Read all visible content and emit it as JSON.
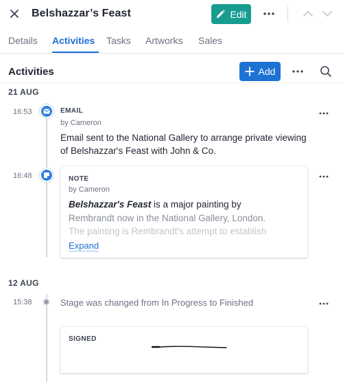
{
  "header": {
    "title": "Belshazzar’s Feast",
    "edit_label": "Edit"
  },
  "tabs": [
    {
      "label": "Details"
    },
    {
      "label": "Activities"
    },
    {
      "label": "Tasks"
    },
    {
      "label": "Artworks"
    },
    {
      "label": "Sales"
    }
  ],
  "section": {
    "title": "Activities",
    "add_label": "Add"
  },
  "groups": [
    {
      "date": "21 AUG",
      "items": [
        {
          "time": "16:53",
          "type": "EMAIL",
          "by": "by Cameron",
          "text": "Email sent to the National Gallery to arrange private viewing of Belshazzar's Feast with John & Co.",
          "icon": "email-icon"
        },
        {
          "time": "16:48",
          "type": "NOTE",
          "by": "by Cameron",
          "bold": "Belshazzar's Feast",
          "line1_rest": " is a major painting by",
          "line2": "Rembrandt now in the National Gallery, London.",
          "line3": "The painting is Rembrandt's attempt to establish",
          "expand_label": "Expand",
          "icon": "note-icon"
        }
      ]
    },
    {
      "date": "12 AUG",
      "items": [
        {
          "time": "15:38",
          "text": "Stage was changed from In Progress to Finished"
        },
        {
          "type": "SIGNED"
        }
      ]
    }
  ],
  "colors": {
    "edit_button": "#179c90",
    "add_button": "#1d72d4",
    "active_tab": "#1d6fd6",
    "timeline_dot": "#2f7fd9"
  }
}
